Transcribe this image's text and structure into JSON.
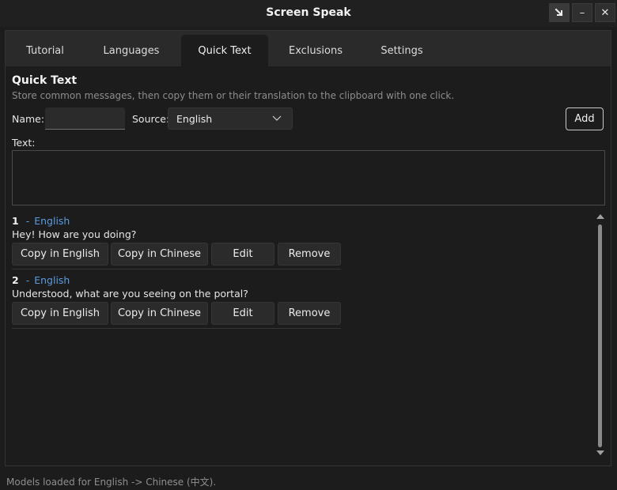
{
  "window": {
    "title": "Screen Speak",
    "restore_icon": "arrow-down-right-icon",
    "minimize_label": "–",
    "close_label": "✕"
  },
  "tabs": [
    {
      "label": "Tutorial"
    },
    {
      "label": "Languages"
    },
    {
      "label": "Quick Text",
      "active": true
    },
    {
      "label": "Exclusions"
    },
    {
      "label": "Settings"
    }
  ],
  "quick_text": {
    "heading": "Quick Text",
    "description": "Store common messages, then copy them or their translation to the clipboard with one click.",
    "name_label": "Name:",
    "name_value": "",
    "source_label": "Source:",
    "source_value": "English",
    "add_label": "Add",
    "text_label": "Text:",
    "text_value": ""
  },
  "entries": [
    {
      "number": "1",
      "dash": "-",
      "language": "English",
      "text": "Hey! How are you doing?",
      "buttons": {
        "copy_source": "Copy in English",
        "copy_target": "Copy in Chinese",
        "edit": "Edit",
        "remove": "Remove"
      }
    },
    {
      "number": "2",
      "dash": "-",
      "language": "English",
      "text": "Understood, what are you seeing on the portal?",
      "buttons": {
        "copy_source": "Copy in English",
        "copy_target": "Copy in Chinese",
        "edit": "Edit",
        "remove": "Remove"
      }
    }
  ],
  "status": "Models loaded for English -> Chinese (中文).",
  "colors": {
    "accent": "#5b9be0",
    "background": "#1c1c1c",
    "panel": "#2a2a2a"
  }
}
